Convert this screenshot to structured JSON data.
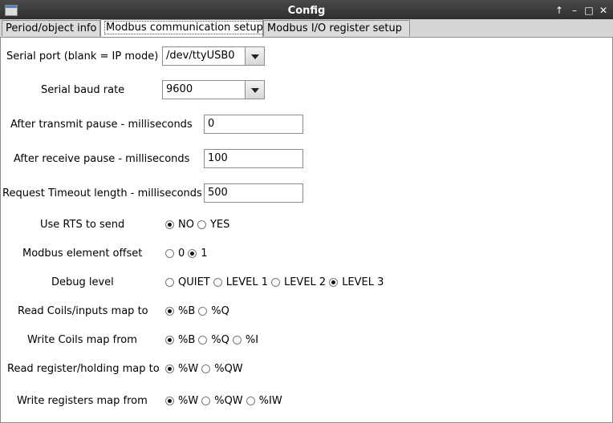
{
  "window": {
    "title": "Config"
  },
  "tabs": [
    {
      "label": "Period/object info"
    },
    {
      "label": "Modbus communication setup"
    },
    {
      "label": "Modbus  I/O register setup"
    }
  ],
  "form": {
    "serial_port": {
      "label": "Serial port (blank = IP mode)",
      "value": "/dev/ttyUSB0"
    },
    "baud_rate": {
      "label": "Serial baud rate",
      "value": "9600"
    },
    "after_transmit": {
      "label": "After transmit pause - milliseconds",
      "value": "0"
    },
    "after_receive": {
      "label": "After receive pause - milliseconds",
      "value": "100"
    },
    "timeout": {
      "label": "Request Timeout length - milliseconds",
      "value": "500"
    },
    "rts": {
      "label": "Use RTS to send",
      "options": [
        "NO",
        "YES"
      ],
      "selected": "NO"
    },
    "offset": {
      "label": "Modbus element offset",
      "options": [
        "0",
        "1"
      ],
      "selected": "1"
    },
    "debug": {
      "label": "Debug level",
      "options": [
        "QUIET",
        "LEVEL 1",
        "LEVEL 2",
        "LEVEL 3"
      ],
      "selected": "LEVEL 3"
    },
    "read_coils": {
      "label": "Read Coils/inputs map to",
      "options": [
        "%B",
        "%Q"
      ],
      "selected": "%B"
    },
    "write_coils": {
      "label": "Write Coils map from",
      "options": [
        "%B",
        "%Q",
        "%I"
      ],
      "selected": "%B"
    },
    "read_register": {
      "label": "Read register/holding map to",
      "options": [
        "%W",
        "%QW"
      ],
      "selected": "%W"
    },
    "write_registers": {
      "label": "Write registers map from",
      "options": [
        "%W",
        "%QW",
        "%IW"
      ],
      "selected": "%W"
    }
  }
}
